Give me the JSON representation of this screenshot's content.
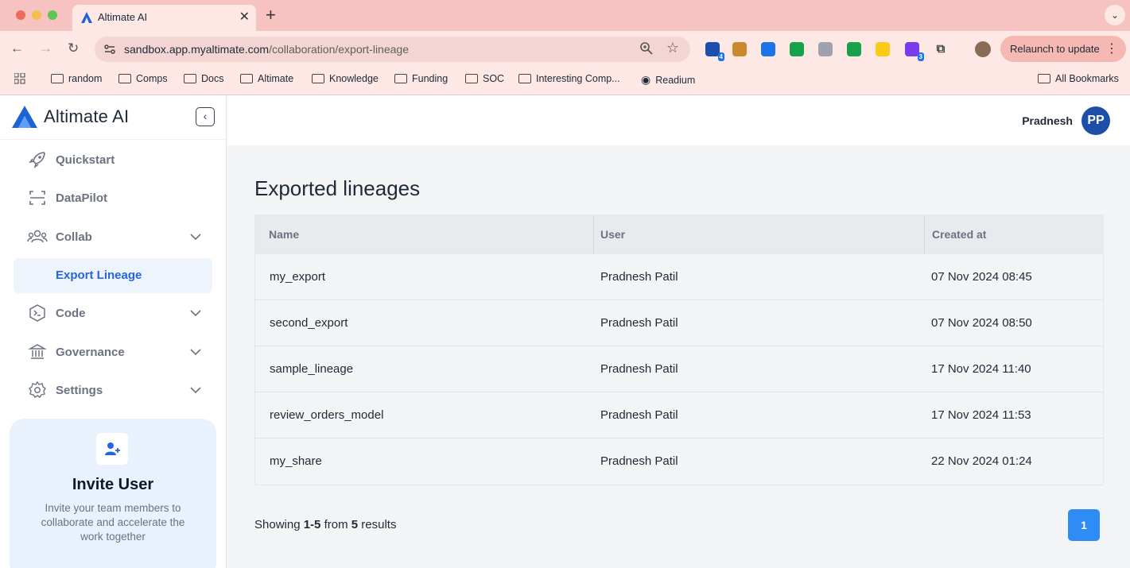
{
  "browser": {
    "tab_title": "Altimate AI",
    "url_domain": "sandbox.app.myaltimate.com",
    "url_path": "/collaboration/export-lineage",
    "relaunch_label": "Relaunch to update",
    "extensions": [
      {
        "name": "extension-1",
        "badge": "4",
        "color": "#1a4fb0"
      },
      {
        "name": "extension-2",
        "badge": "",
        "color": "#c98a2e"
      },
      {
        "name": "extension-3",
        "badge": "",
        "color": "#1a73e8"
      },
      {
        "name": "grammarly",
        "badge": "",
        "color": "#15a34a"
      },
      {
        "name": "extension-5",
        "badge": "",
        "color": "#9ca3af"
      },
      {
        "name": "extension-6",
        "badge": "",
        "color": "#16a34a"
      },
      {
        "name": "extension-7",
        "badge": "",
        "color": "#facc15"
      },
      {
        "name": "extension-8",
        "badge": "3",
        "color": "#7c3aed"
      }
    ],
    "bookmarks": [
      "random",
      "Comps",
      "Docs",
      "Altimate",
      "Knowledge",
      "Funding",
      "SOC",
      "Interesting Comp...",
      "Readium"
    ],
    "all_bookmarks": "All Bookmarks"
  },
  "sidebar": {
    "brand": "Altimate AI",
    "items": [
      {
        "label": "Quickstart",
        "icon": "rocket-icon"
      },
      {
        "label": "DataPilot",
        "icon": "scan-icon"
      },
      {
        "label": "Collab",
        "icon": "users-icon"
      },
      {
        "label": "Export Lineage",
        "icon": ""
      },
      {
        "label": "Code",
        "icon": "terminal-icon"
      },
      {
        "label": "Governance",
        "icon": "bank-icon"
      },
      {
        "label": "Settings",
        "icon": "gear-icon"
      }
    ],
    "invite": {
      "title": "Invite User",
      "description": "Invite your team members to collaborate and accelerate the work together"
    }
  },
  "header": {
    "user_name": "Pradnesh",
    "avatar_initials": "PP"
  },
  "main": {
    "title": "Exported lineages",
    "columns": [
      "Name",
      "User",
      "Created at"
    ],
    "rows": [
      {
        "name": "my_export",
        "user": "Pradnesh Patil",
        "created_at": "07 Nov 2024 08:45"
      },
      {
        "name": "second_export",
        "user": "Pradnesh Patil",
        "created_at": "07 Nov 2024 08:50"
      },
      {
        "name": "sample_lineage",
        "user": "Pradnesh Patil",
        "created_at": "17 Nov 2024 11:40"
      },
      {
        "name": "review_orders_model",
        "user": "Pradnesh Patil",
        "created_at": "17 Nov 2024 11:53"
      },
      {
        "name": "my_share",
        "user": "Pradnesh Patil",
        "created_at": "22 Nov 2024 01:24"
      }
    ],
    "footer": {
      "prefix": "Showing",
      "range": "1-5",
      "middle": "from",
      "total": "5",
      "suffix": "results"
    },
    "page": "1"
  }
}
